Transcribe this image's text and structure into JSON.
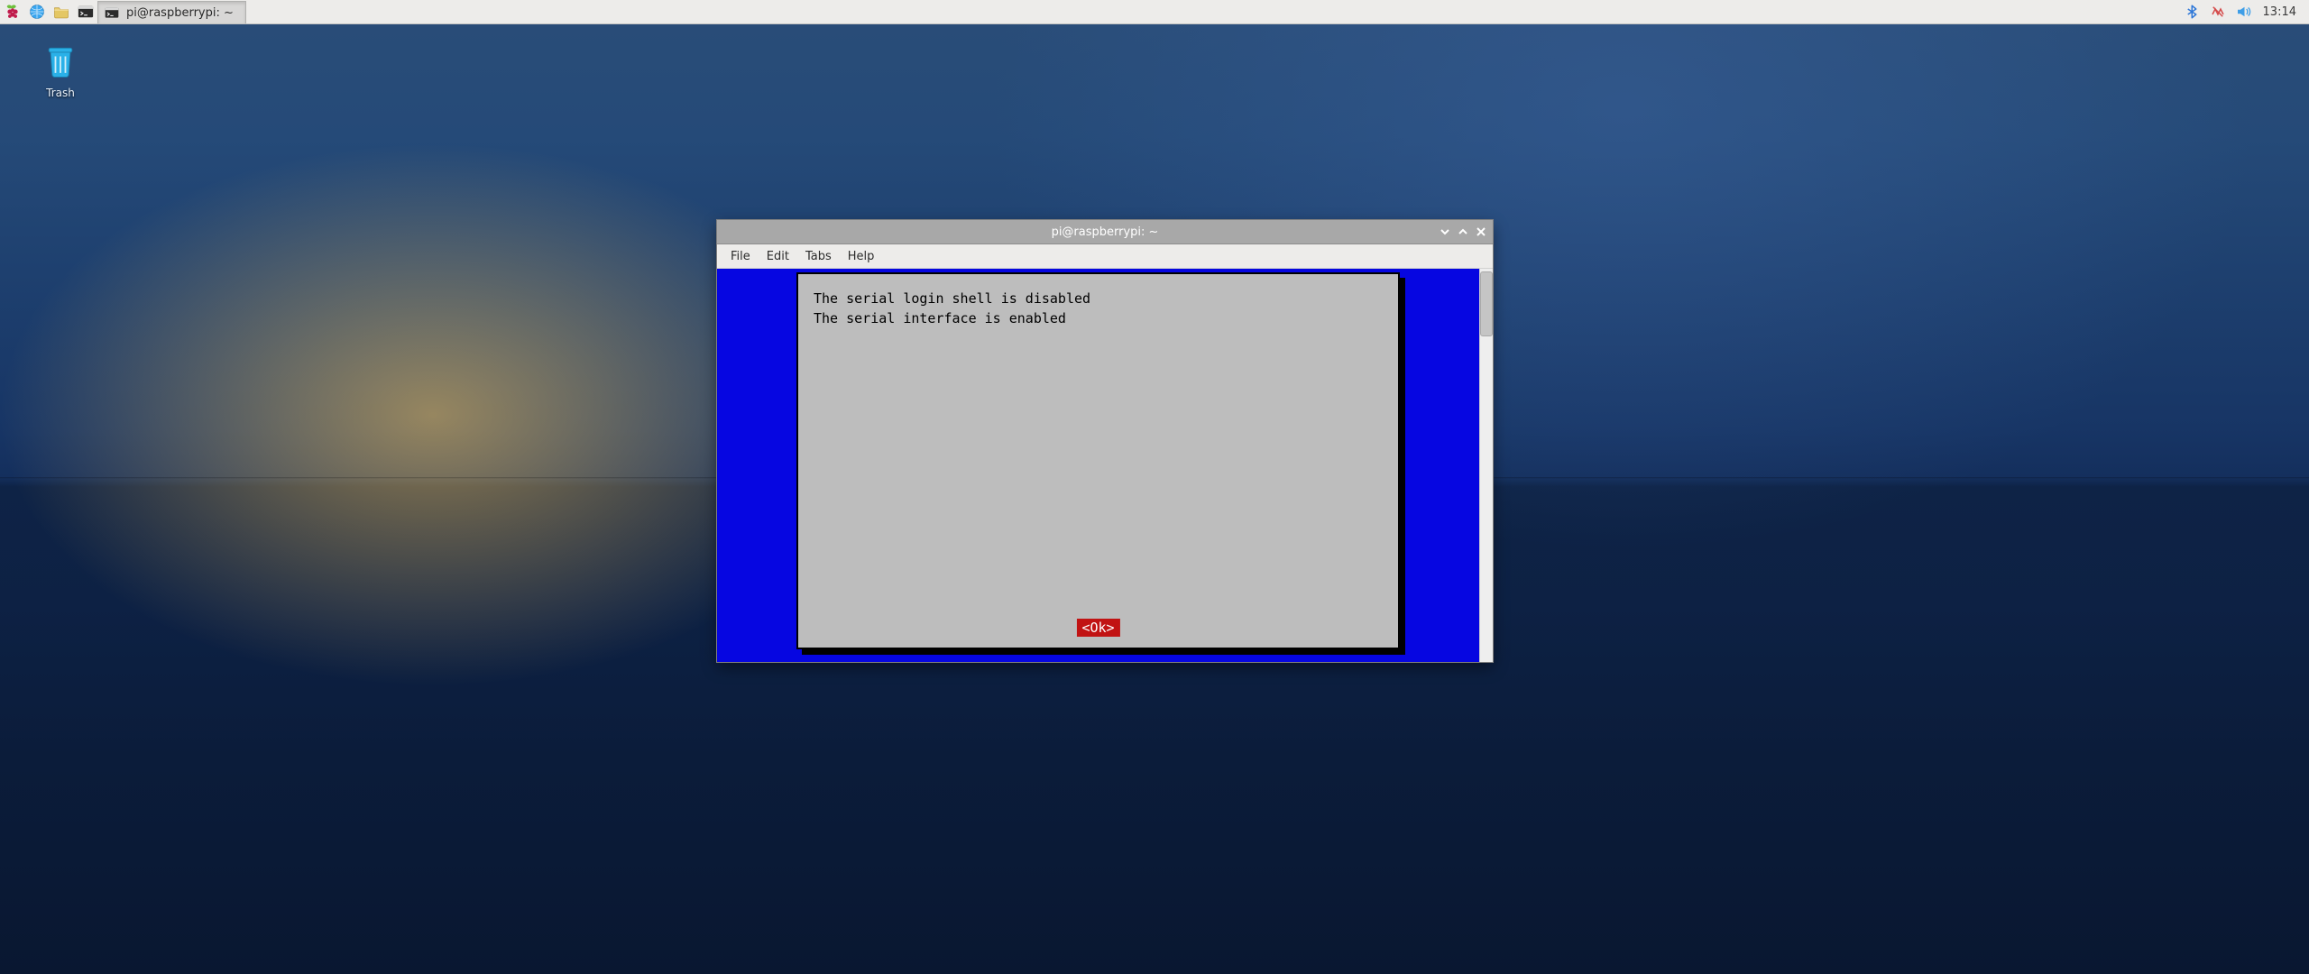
{
  "panel": {
    "taskbar_window_label": "pi@raspberrypi: ~",
    "clock": "13:14"
  },
  "desktop": {
    "trash_label": "Trash"
  },
  "window": {
    "title": "pi@raspberrypi: ~",
    "menus": [
      "File",
      "Edit",
      "Tabs",
      "Help"
    ]
  },
  "dialog": {
    "line1": "The serial login shell is disabled",
    "line2": "The serial interface is enabled",
    "ok_label": "<Ok>"
  }
}
